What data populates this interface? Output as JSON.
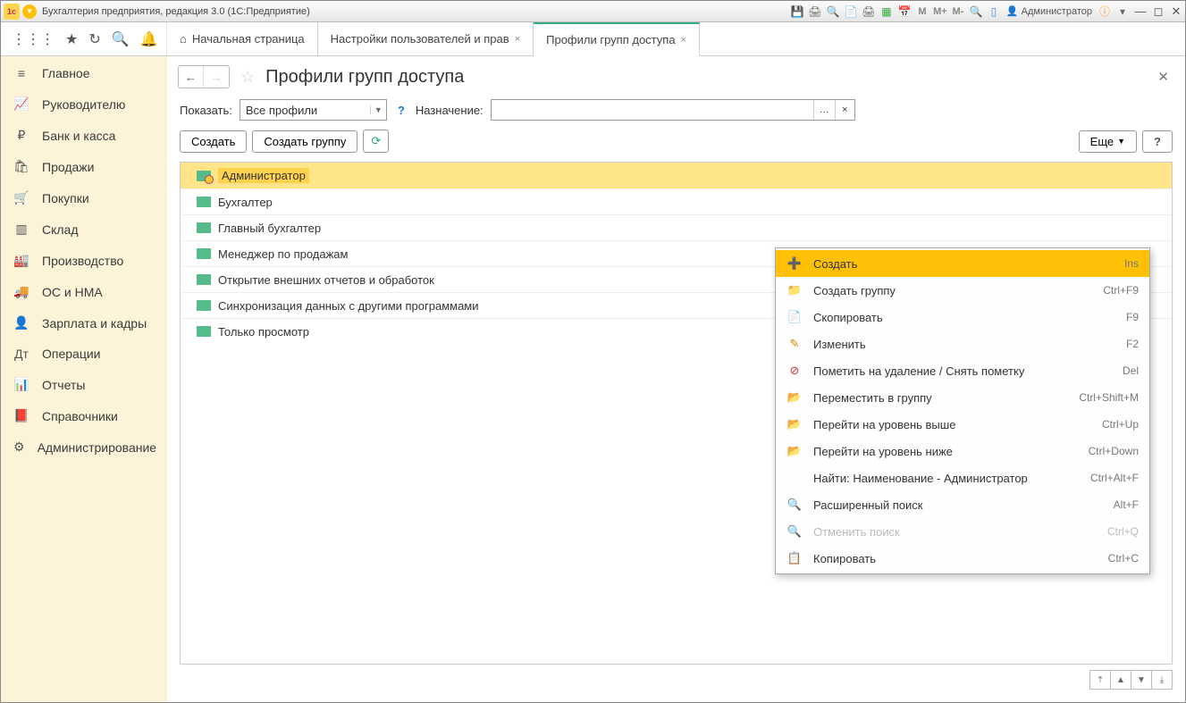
{
  "window_title": "Бухгалтерия предприятия, редакция 3.0  (1С:Предприятие)",
  "titlebar_user": "Администратор",
  "titlebar_icons_letters": [
    "M",
    "M+",
    "M-"
  ],
  "tabs": [
    {
      "label": "Начальная страница",
      "home": true,
      "closable": false
    },
    {
      "label": "Настройки пользователей и прав",
      "closable": true
    },
    {
      "label": "Профили групп доступа",
      "closable": true,
      "active": true
    }
  ],
  "sidebar": [
    {
      "icon": "≡",
      "label": "Главное"
    },
    {
      "icon": "📈",
      "label": "Руководителю"
    },
    {
      "icon": "₽",
      "label": "Банк и касса"
    },
    {
      "icon": "🛍",
      "label": "Продажи"
    },
    {
      "icon": "🛒",
      "label": "Покупки"
    },
    {
      "icon": "▥",
      "label": "Склад"
    },
    {
      "icon": "🏭",
      "label": "Производство"
    },
    {
      "icon": "🚚",
      "label": "ОС и НМА"
    },
    {
      "icon": "👤",
      "label": "Зарплата и кадры"
    },
    {
      "icon": "Дт",
      "label": "Операции"
    },
    {
      "icon": "📊",
      "label": "Отчеты"
    },
    {
      "icon": "📕",
      "label": "Справочники"
    },
    {
      "icon": "⚙",
      "label": "Администрирование"
    }
  ],
  "page": {
    "title": "Профили групп доступа",
    "filter_label": "Показать:",
    "filter_value": "Все профили",
    "assign_label": "Назначение:",
    "assign_value": "",
    "btn_create": "Создать",
    "btn_create_group": "Создать группу",
    "btn_more": "Еще",
    "btn_help": "?"
  },
  "list_rows": [
    {
      "label": "Администратор",
      "selected": true,
      "locked": true
    },
    {
      "label": "Бухгалтер"
    },
    {
      "label": "Главный бухгалтер"
    },
    {
      "label": "Менеджер по продажам"
    },
    {
      "label": "Открытие внешних отчетов и обработок"
    },
    {
      "label": "Синхронизация данных с другими программами"
    },
    {
      "label": "Только просмотр"
    }
  ],
  "context_menu": [
    {
      "icon": "➕",
      "icon_color": "#2a2",
      "label": "Создать",
      "shortcut": "Ins",
      "highlight": true
    },
    {
      "icon": "📁",
      "icon_color": "#e90",
      "label": "Создать группу",
      "shortcut": "Ctrl+F9"
    },
    {
      "icon": "📄",
      "icon_color": "#5a5",
      "label": "Скопировать",
      "shortcut": "F9"
    },
    {
      "icon": "✎",
      "icon_color": "#c80",
      "label": "Изменить",
      "shortcut": "F2"
    },
    {
      "icon": "⊘",
      "icon_color": "#c33",
      "label": "Пометить на удаление / Снять пометку",
      "shortcut": "Del"
    },
    {
      "icon": "📂",
      "icon_color": "#e90",
      "label": "Переместить в группу",
      "shortcut": "Ctrl+Shift+M"
    },
    {
      "icon": "📂",
      "icon_color": "#e90",
      "label": "Перейти на уровень выше",
      "shortcut": "Ctrl+Up"
    },
    {
      "icon": "📂",
      "icon_color": "#e90",
      "label": "Перейти на уровень ниже",
      "shortcut": "Ctrl+Down"
    },
    {
      "icon": "",
      "label": "Найти: Наименование - Администратор",
      "shortcut": "Ctrl+Alt+F"
    },
    {
      "icon": "🔍",
      "icon_color": "#48c",
      "label": "Расширенный поиск",
      "shortcut": "Alt+F"
    },
    {
      "icon": "🔍",
      "icon_color": "#bbb",
      "label": "Отменить поиск",
      "shortcut": "Ctrl+Q",
      "disabled": true
    },
    {
      "icon": "📋",
      "icon_color": "#888",
      "label": "Копировать",
      "shortcut": "Ctrl+C"
    }
  ]
}
